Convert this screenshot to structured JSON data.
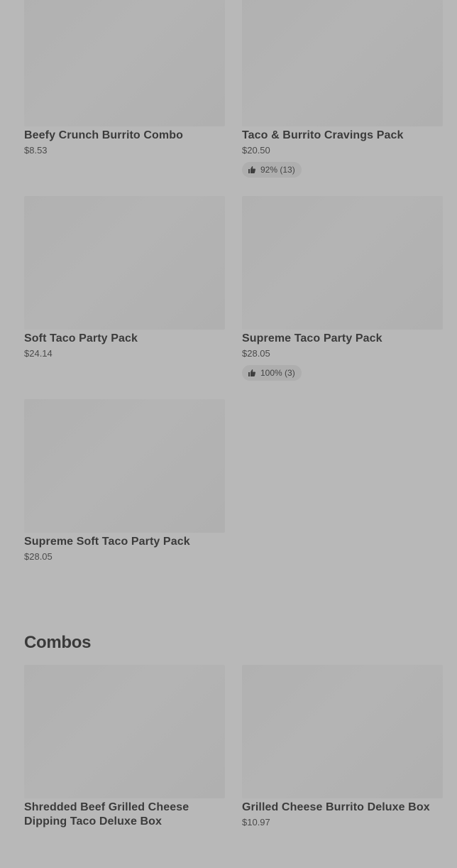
{
  "menu_items": [
    {
      "title": "Beefy Crunch Burrito Combo",
      "price": "$8.53",
      "rating": ""
    },
    {
      "title": "Taco & Burrito Cravings Pack",
      "price": "$20.50",
      "rating": "92% (13)"
    },
    {
      "title": "Soft Taco Party Pack",
      "price": "$24.14",
      "rating": ""
    },
    {
      "title": "Supreme Taco Party Pack",
      "price": "$28.05",
      "rating": "100% (3)"
    },
    {
      "title": "Supreme Soft Taco Party Pack",
      "price": "$28.05",
      "rating": ""
    }
  ],
  "combos": {
    "heading": "Combos",
    "items": [
      {
        "title": "Shredded Beef Grilled Cheese Dipping Taco Deluxe Box",
        "price": ""
      },
      {
        "title": "Grilled Cheese Burrito Deluxe Box",
        "price": "$10.97"
      }
    ]
  },
  "icons": {
    "rating": "thumbs-up-icon"
  }
}
